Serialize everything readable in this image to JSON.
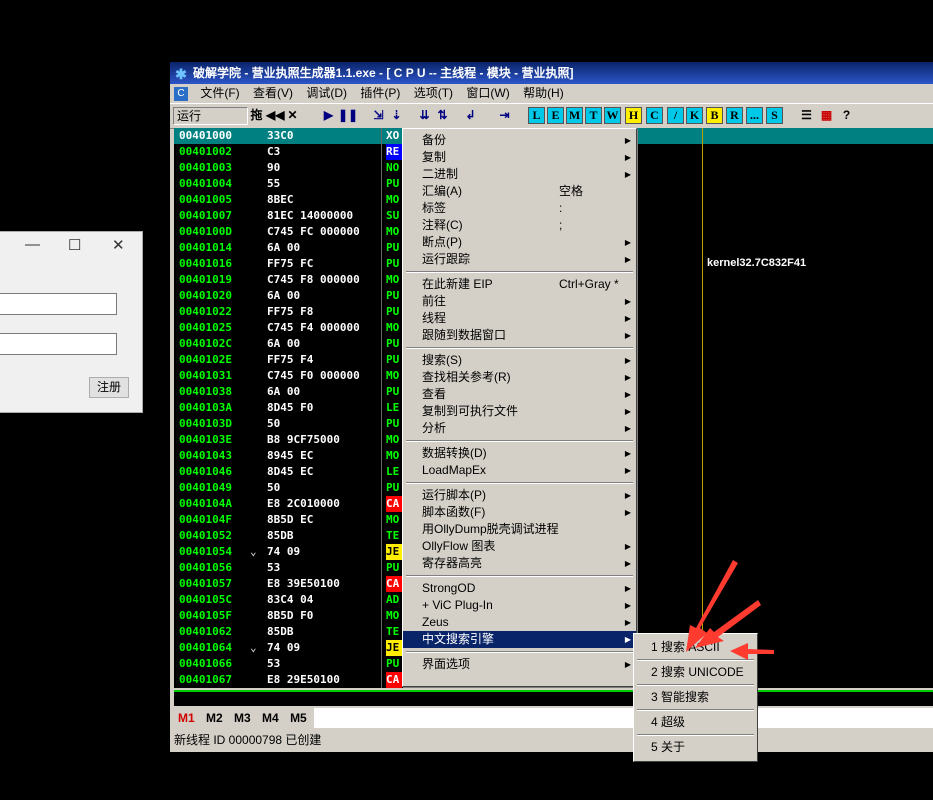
{
  "dialog": {
    "register_label": "注册"
  },
  "window": {
    "title": "破解学院 - 营业执照生成器1.1.exe - [ C P U -- 主线程 - 模块 - 营业执照]",
    "menu": [
      "文件(F)",
      "查看(V)",
      "调试(D)",
      "插件(P)",
      "选项(T)",
      "窗口(W)",
      "帮助(H)"
    ],
    "toolbar": {
      "status": "运行",
      "letters": [
        "L",
        "E",
        "M",
        "T",
        "W",
        "H",
        "C",
        "/",
        "K",
        "B",
        "R",
        "...",
        "S"
      ]
    }
  },
  "disasm": [
    {
      "addr": "00401000",
      "hex": "33C0",
      "op": "XO",
      "sel": true
    },
    {
      "addr": "00401002",
      "hex": "C3",
      "op": "RE"
    },
    {
      "addr": "00401003",
      "hex": "90",
      "op": "NO"
    },
    {
      "addr": "00401004",
      "hex": "55",
      "op": "PU"
    },
    {
      "addr": "00401005",
      "hex": "8BEC",
      "op": "MO"
    },
    {
      "addr": "00401007",
      "hex": "81EC 14000000",
      "op": "SU"
    },
    {
      "addr": "0040100D",
      "hex": "C745 FC 000000",
      "op": "MO"
    },
    {
      "addr": "00401014",
      "hex": "6A 00",
      "op": "PU"
    },
    {
      "addr": "00401016",
      "hex": "FF75 FC",
      "op": "PU"
    },
    {
      "addr": "00401019",
      "hex": "C745 F8 000000",
      "op": "MO"
    },
    {
      "addr": "00401020",
      "hex": "6A 00",
      "op": "PU"
    },
    {
      "addr": "00401022",
      "hex": "FF75 F8",
      "op": "PU"
    },
    {
      "addr": "00401025",
      "hex": "C745 F4 000000",
      "op": "MO"
    },
    {
      "addr": "0040102C",
      "hex": "6A 00",
      "op": "PU"
    },
    {
      "addr": "0040102E",
      "hex": "FF75 F4",
      "op": "PU"
    },
    {
      "addr": "00401031",
      "hex": "C745 F0 000000",
      "op": "MO"
    },
    {
      "addr": "00401038",
      "hex": "6A 00",
      "op": "PU"
    },
    {
      "addr": "0040103A",
      "hex": "8D45 F0",
      "op": "LE"
    },
    {
      "addr": "0040103D",
      "hex": "50",
      "op": "PU"
    },
    {
      "addr": "0040103E",
      "hex": "B8 9CF75000",
      "op": "MO"
    },
    {
      "addr": "00401043",
      "hex": "8945 EC",
      "op": "MO"
    },
    {
      "addr": "00401046",
      "hex": "8D45 EC",
      "op": "LE"
    },
    {
      "addr": "00401049",
      "hex": "50",
      "op": "PU"
    },
    {
      "addr": "0040104A",
      "hex": "E8 2C010000",
      "op": "CA"
    },
    {
      "addr": "0040104F",
      "hex": "8B5D EC",
      "op": "MO"
    },
    {
      "addr": "00401052",
      "hex": "85DB",
      "op": "TE"
    },
    {
      "addr": "00401054",
      "hex": "74 09",
      "op": "JE",
      "arrow": "⌄"
    },
    {
      "addr": "00401056",
      "hex": "53",
      "op": "PU"
    },
    {
      "addr": "00401057",
      "hex": "E8 39E50100",
      "op": "CA"
    },
    {
      "addr": "0040105C",
      "hex": "83C4 04",
      "op": "AD"
    },
    {
      "addr": "0040105F",
      "hex": "8B5D F0",
      "op": "MO"
    },
    {
      "addr": "00401062",
      "hex": "85DB",
      "op": "TE"
    },
    {
      "addr": "00401064",
      "hex": "74 09",
      "op": "JE",
      "arrow": "⌄"
    },
    {
      "addr": "00401066",
      "hex": "53",
      "op": "PU"
    },
    {
      "addr": "00401067",
      "hex": "E8 29E50100",
      "op": "CA"
    }
  ],
  "kernel_comment": "kernel32.7C832F41",
  "bottom": {
    "tabs": [
      "M1",
      "M2",
      "M3",
      "M4",
      "M5"
    ],
    "status": "新线程 ID 00000798 已创建"
  },
  "context_menu": [
    {
      "label": "备份",
      "sub": true
    },
    {
      "label": "复制",
      "sub": true
    },
    {
      "label": "二进制",
      "sub": true
    },
    {
      "label": "汇编(A)",
      "shortcut": "空格"
    },
    {
      "label": "标签",
      "shortcut": ":"
    },
    {
      "label": "注释(C)",
      "shortcut": ";"
    },
    {
      "label": "断点(P)",
      "sub": true
    },
    {
      "label": "运行跟踪",
      "sub": true
    },
    {
      "sep": true
    },
    {
      "label": "在此新建 EIP",
      "shortcut": "Ctrl+Gray *"
    },
    {
      "label": "前往",
      "sub": true
    },
    {
      "label": "线程",
      "sub": true
    },
    {
      "label": "跟随到数据窗口",
      "sub": true
    },
    {
      "sep": true
    },
    {
      "label": "搜索(S)",
      "sub": true
    },
    {
      "label": "查找相关参考(R)",
      "sub": true
    },
    {
      "label": "查看",
      "sub": true
    },
    {
      "label": "复制到可执行文件",
      "sub": true
    },
    {
      "label": "分析",
      "sub": true
    },
    {
      "sep": true
    },
    {
      "label": "数据转换(D)",
      "sub": true
    },
    {
      "label": "LoadMapEx",
      "sub": true
    },
    {
      "sep": true
    },
    {
      "label": "运行脚本(P)",
      "sub": true
    },
    {
      "label": "脚本函数(F)",
      "sub": true
    },
    {
      "label": "用OllyDump脱壳调试进程"
    },
    {
      "label": "OllyFlow 图表",
      "sub": true
    },
    {
      "label": "寄存器高亮",
      "sub": true
    },
    {
      "sep": true
    },
    {
      "label": "StrongOD",
      "sub": true
    },
    {
      "label": "+ ViC Plug-In",
      "sub": true
    },
    {
      "label": "Zeus",
      "sub": true
    },
    {
      "label": "中文搜索引擎",
      "sub": true,
      "hl": true
    },
    {
      "sep": true
    },
    {
      "label": "界面选项",
      "sub": true
    }
  ],
  "submenu": [
    "1 搜索 ASCII",
    "2 搜索 UNICODE",
    "3 智能搜索",
    "4 超级",
    "5 关于"
  ],
  "colors": {
    "accent": "#0a246a",
    "arrow": "#ff3b30"
  }
}
